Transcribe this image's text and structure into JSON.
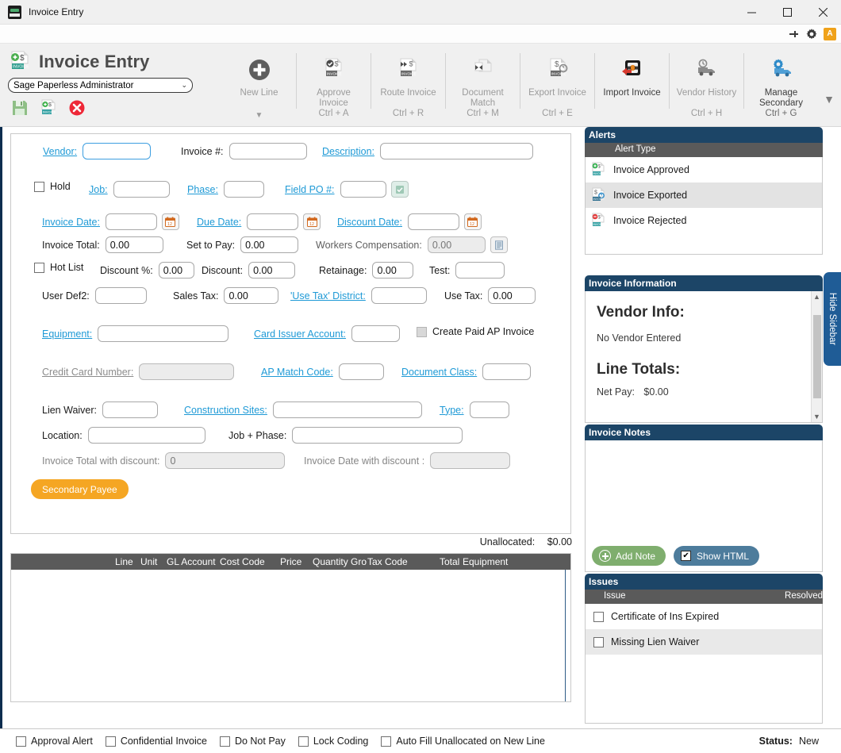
{
  "window": {
    "title": "Invoice Entry",
    "app_icon": "invoice-app-icon",
    "minimize": "─",
    "maximize": "☐",
    "close": "✕"
  },
  "utilbar": {
    "pin_icon": "pin-icon",
    "gear_icon": "gear-icon",
    "badge_label": "A"
  },
  "ribbon": {
    "app_title": "Invoice Entry",
    "user_select": {
      "value": "Sage Paperless Administrator",
      "arrow": "⌄"
    },
    "quick_actions": [
      {
        "name": "save-icon",
        "label": "Save"
      },
      {
        "name": "save-new-invoice-icon",
        "label": "Save and New"
      },
      {
        "name": "delete-icon",
        "label": "Delete"
      }
    ],
    "buttons": [
      {
        "label": "New Line",
        "shortcut": "",
        "enabled": false,
        "has_caret": true,
        "icon": "plus-circle-icon"
      },
      {
        "label": "Approve\nInvoice",
        "shortcut": "Ctrl + A",
        "enabled": false,
        "has_caret": false,
        "icon": "approve-invoice-icon"
      },
      {
        "label": "Route Invoice",
        "shortcut": "Ctrl + R",
        "enabled": false,
        "has_caret": false,
        "icon": "route-invoice-icon"
      },
      {
        "label": "Document\nMatch",
        "shortcut": "Ctrl + M",
        "enabled": false,
        "has_caret": false,
        "icon": "document-match-icon"
      },
      {
        "label": "Export Invoice",
        "shortcut": "Ctrl + E",
        "enabled": false,
        "has_caret": false,
        "icon": "export-invoice-icon"
      },
      {
        "label": "Import Invoice",
        "shortcut": "",
        "enabled": true,
        "has_caret": false,
        "icon": "import-invoice-icon"
      },
      {
        "label": "Vendor History",
        "shortcut": "Ctrl + H",
        "enabled": false,
        "has_caret": false,
        "icon": "vendor-history-icon"
      },
      {
        "label": "Manage\nSecondary",
        "shortcut": "Ctrl + G",
        "enabled": true,
        "has_caret": false,
        "icon": "manage-secondary-icon"
      }
    ],
    "expander": "▼"
  },
  "form": {
    "vendor_label": "Vendor:",
    "vendor_value": "",
    "invoice_num_label": "Invoice #:",
    "invoice_num_value": "",
    "description_label": "Description:",
    "description_value": "",
    "hold_label": "Hold",
    "hold_checked": false,
    "job_label": "Job:",
    "job_value": "",
    "phase_label": "Phase:",
    "phase_value": "",
    "field_po_label": "Field PO #:",
    "field_po_value": "",
    "invoice_date_label": "Invoice Date:",
    "invoice_date_value": "",
    "due_date_label": "Due Date:",
    "due_date_value": "",
    "discount_date_label": "Discount Date:",
    "discount_date_value": "",
    "invoice_total_label": "Invoice Total:",
    "invoice_total_value": "0.00",
    "set_to_pay_label": "Set to Pay:",
    "set_to_pay_value": "0.00",
    "workers_comp_label": "Workers Compensation:",
    "workers_comp_value": "0.00",
    "hot_list_label": "Hot List",
    "hot_list_checked": false,
    "discount_pct_label": "Discount %:",
    "discount_pct_value": "0.00",
    "discount_label": "Discount:",
    "discount_value": "0.00",
    "retainage_label": "Retainage:",
    "retainage_value": "0.00",
    "test_label": "Test:",
    "test_value": "",
    "user_def2_label": "User Def2:",
    "user_def2_value": "",
    "sales_tax_label": "Sales Tax:",
    "sales_tax_value": "0.00",
    "use_tax_district_label": "'Use Tax' District:",
    "use_tax_district_value": "",
    "use_tax_label": "Use Tax:",
    "use_tax_value": "0.00",
    "equipment_label": "Equipment:",
    "equipment_value": "",
    "card_issuer_label": "Card Issuer Account:",
    "card_issuer_value": "",
    "create_paid_ap_label": "Create Paid AP Invoice",
    "create_paid_ap_checked": false,
    "credit_card_label": "Credit Card Number:",
    "credit_card_value": "",
    "ap_match_label": "AP Match Code:",
    "ap_match_value": "",
    "document_class_label": "Document Class:",
    "document_class_value": "",
    "lien_waiver_label": "Lien Waiver:",
    "lien_waiver_value": "",
    "construction_sites_label": "Construction Sites:",
    "construction_sites_value": "",
    "type_label": "Type:",
    "type_value": "",
    "location_label": "Location:",
    "location_value": "",
    "job_phase_label": "Job + Phase:",
    "job_phase_value": "",
    "total_with_discount_label": "Invoice Total with discount:",
    "total_with_discount_value": "0",
    "date_with_discount_label": "Invoice Date with discount :",
    "date_with_discount_value": "",
    "secondary_payee_button": "Secondary Payee",
    "unallocated_label": "Unallocated:",
    "unallocated_value": "$0.00"
  },
  "grid": {
    "columns": [
      "Line",
      "Unit",
      "GL Account",
      "Cost Code",
      "Price",
      "Quantity",
      "Gro",
      "Tax Code",
      "Total",
      "Equipment"
    ],
    "rows": []
  },
  "sidebar": {
    "hide_tab_label": "Hide Sidebar",
    "alerts": {
      "title": "Alerts",
      "column": "Alert Type",
      "items": [
        {
          "label": "Invoice Approved",
          "icon": "invoice-approved-icon",
          "selected": false
        },
        {
          "label": "Invoice Exported",
          "icon": "invoice-exported-icon",
          "selected": true
        },
        {
          "label": "Invoice Rejected",
          "icon": "invoice-rejected-icon",
          "selected": false
        }
      ]
    },
    "invoice_information": {
      "title": "Invoice Information",
      "vendor_info_heading": "Vendor Info:",
      "vendor_info_text": "No Vendor Entered",
      "line_totals_heading": "Line Totals:",
      "net_pay_label": "Net Pay:",
      "net_pay_value": "$0.00"
    },
    "invoice_notes": {
      "title": "Invoice Notes",
      "content": "",
      "add_note_button": "Add Note",
      "show_html_button": "Show HTML",
      "show_html_checked": true
    },
    "issues": {
      "title": "Issues",
      "col_issue": "Issue",
      "col_resolved": "Resolved",
      "items": [
        {
          "label": "Certificate of Ins Expired",
          "resolved": false
        },
        {
          "label": "Missing Lien Waiver",
          "resolved": false
        }
      ]
    }
  },
  "statusbar": {
    "checks": [
      {
        "label": "Approval Alert",
        "checked": false
      },
      {
        "label": "Confidential Invoice",
        "checked": false
      },
      {
        "label": "Do Not Pay",
        "checked": false
      },
      {
        "label": "Lock Coding",
        "checked": false
      },
      {
        "label": "Auto Fill Unallocated on New Line",
        "checked": false
      }
    ],
    "status_label": "Status:",
    "status_value": "New"
  },
  "colors": {
    "panel_header": "#1c4567",
    "grid_header": "#5a5a5a",
    "link": "#1f9ad6",
    "accent_orange": "#f5a623",
    "green": "#7fae6e",
    "blue": "#4d7c9c"
  }
}
